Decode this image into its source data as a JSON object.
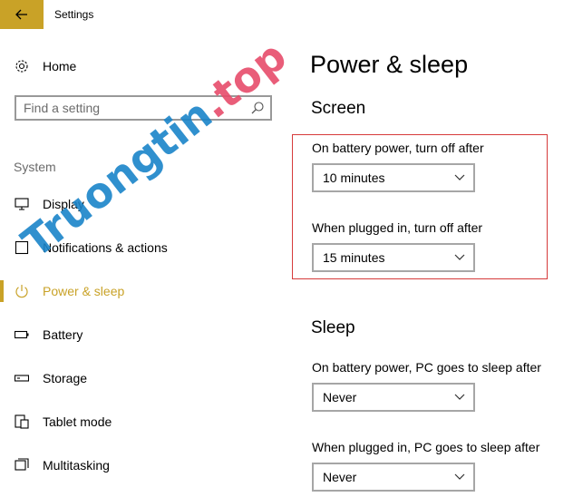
{
  "app": {
    "title": "Settings"
  },
  "sidebar": {
    "home_label": "Home",
    "search": {
      "placeholder": "Find a setting"
    },
    "group_label": "System",
    "items": [
      {
        "label": "Display",
        "icon": "monitor-icon",
        "active": false
      },
      {
        "label": "Notifications & actions",
        "icon": "notification-icon",
        "active": false
      },
      {
        "label": "Power & sleep",
        "icon": "power-icon",
        "active": true
      },
      {
        "label": "Battery",
        "icon": "battery-icon",
        "active": false
      },
      {
        "label": "Storage",
        "icon": "storage-icon",
        "active": false
      },
      {
        "label": "Tablet mode",
        "icon": "tablet-mode-icon",
        "active": false
      },
      {
        "label": "Multitasking",
        "icon": "multitasking-icon",
        "active": false
      }
    ]
  },
  "main": {
    "title": "Power & sleep",
    "screen": {
      "heading": "Screen",
      "battery_label": "On battery power, turn off after",
      "battery_value": "10 minutes",
      "plugged_label": "When plugged in, turn off after",
      "plugged_value": "15 minutes"
    },
    "sleep": {
      "heading": "Sleep",
      "battery_label": "On battery power, PC goes to sleep after",
      "battery_value": "Never",
      "plugged_label": "When plugged in, PC goes to sleep after",
      "plugged_value": "Never"
    }
  },
  "watermark": {
    "part1": "Truongtin",
    "part2": ".top"
  },
  "colors": {
    "accent": "#c9a227",
    "highlight": "#d63b3b",
    "watermark_blue": "#1a84c9",
    "watermark_pink": "#e74c6b"
  }
}
